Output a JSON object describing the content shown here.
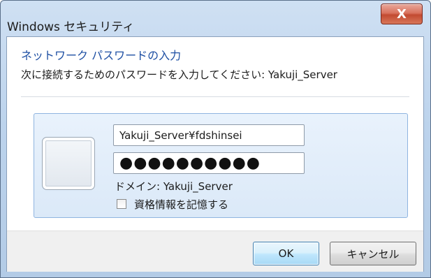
{
  "window": {
    "title": "Windows セキュリティ",
    "close_icon": "close-icon",
    "close_glyph": "X"
  },
  "dialog": {
    "heading": "ネットワーク パスワードの入力",
    "instruction": "次に接続するためのパスワードを入力してください: Yakuji_Server"
  },
  "credentials": {
    "avatar_icon": "user-tile-icon",
    "username_value": "Yakuji_Server¥fdshinsei",
    "password_value": "●●●●●●●●●●",
    "domain_text": "ドメイン: Yakuji_Server",
    "remember_label": "資格情報を記憶する",
    "remember_checked": false
  },
  "buttons": {
    "ok_label": "OK",
    "cancel_label": "キャンセル"
  },
  "colors": {
    "heading": "#1e4fa3",
    "close_button": "#c24a31",
    "panel_border": "#8fb4e0"
  }
}
